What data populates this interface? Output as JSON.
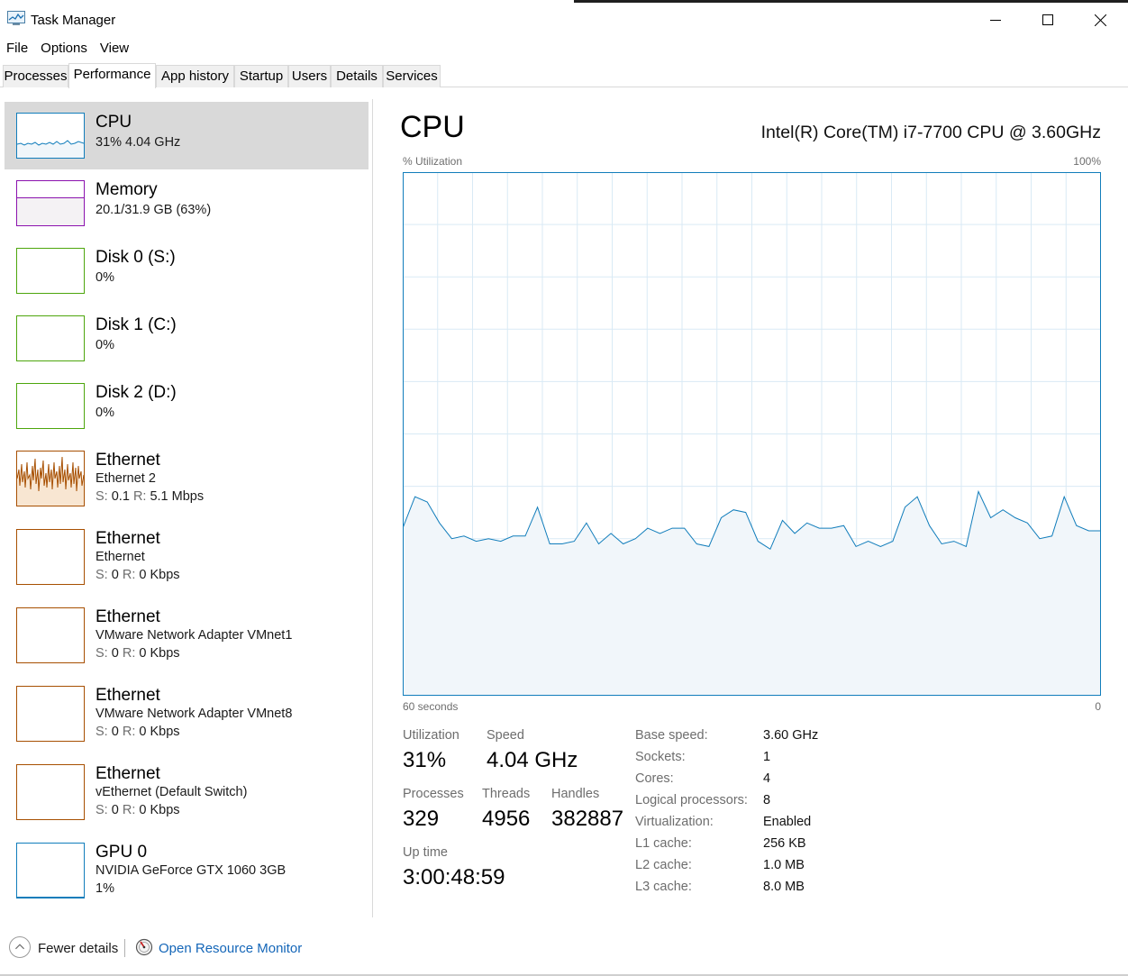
{
  "window": {
    "title": "Task Manager",
    "icon": "task-manager-icon",
    "controls": [
      "minimize-icon",
      "maximize-icon",
      "close-icon"
    ]
  },
  "menu": [
    "File",
    "Options",
    "View"
  ],
  "tabs": [
    {
      "label": "Processes",
      "active": false
    },
    {
      "label": "Performance",
      "active": true
    },
    {
      "label": "App history",
      "active": false
    },
    {
      "label": "Startup",
      "active": false
    },
    {
      "label": "Users",
      "active": false
    },
    {
      "label": "Details",
      "active": false
    },
    {
      "label": "Services",
      "active": false
    }
  ],
  "sidebar": {
    "items": [
      {
        "title": "CPU",
        "line1": "31% 4.04 GHz",
        "selected": true,
        "color": "#117dbb"
      },
      {
        "title": "Memory",
        "line1": "20.1/31.9 GB (63%)",
        "color": "#8b12ae",
        "fill": 0.63
      },
      {
        "title": "Disk 0 (S:)",
        "line1": "0%",
        "color": "#4da60c"
      },
      {
        "title": "Disk 1 (C:)",
        "line1": "0%",
        "color": "#4da60c"
      },
      {
        "title": "Disk 2 (D:)",
        "line1": "0%",
        "color": "#4da60c"
      },
      {
        "title": "Ethernet",
        "line1": "Ethernet 2",
        "send_label": "S:",
        "send": "0.1",
        "recv_label": "R:",
        "recv": "5.1 Mbps",
        "color": "#a74f01"
      },
      {
        "title": "Ethernet",
        "line1": "Ethernet",
        "send_label": "S:",
        "send": "0",
        "recv_label": "R:",
        "recv": "0 Kbps",
        "color": "#a74f01"
      },
      {
        "title": "Ethernet",
        "line1": "VMware Network Adapter VMnet1",
        "send_label": "S:",
        "send": "0",
        "recv_label": "R:",
        "recv": "0 Kbps",
        "color": "#a74f01"
      },
      {
        "title": "Ethernet",
        "line1": "VMware Network Adapter VMnet8",
        "send_label": "S:",
        "send": "0",
        "recv_label": "R:",
        "recv": "0 Kbps",
        "color": "#a74f01"
      },
      {
        "title": "Ethernet",
        "line1": "vEthernet (Default Switch)",
        "send_label": "S:",
        "send": "0",
        "recv_label": "R:",
        "recv": "0 Kbps",
        "color": "#a74f01"
      },
      {
        "title": "GPU 0",
        "line1": "NVIDIA GeForce GTX 1060 3GB",
        "line2": "1%",
        "color": "#117dbb"
      }
    ]
  },
  "detail": {
    "title": "CPU",
    "model": "Intel(R) Core(TM) i7-7700 CPU @ 3.60GHz",
    "axis_top_left": "% Utilization",
    "axis_top_right": "100%",
    "axis_bottom_left": "60 seconds",
    "axis_bottom_right": "0",
    "stats": {
      "utilization_label": "Utilization",
      "utilization": "31%",
      "speed_label": "Speed",
      "speed": "4.04 GHz",
      "processes_label": "Processes",
      "processes": "329",
      "threads_label": "Threads",
      "threads": "4956",
      "handles_label": "Handles",
      "handles": "382887",
      "uptime_label": "Up time",
      "uptime": "3:00:48:59"
    },
    "specs": [
      {
        "label": "Base speed:",
        "value": "3.60 GHz"
      },
      {
        "label": "Sockets:",
        "value": "1"
      },
      {
        "label": "Cores:",
        "value": "4"
      },
      {
        "label": "Logical processors:",
        "value": "8"
      },
      {
        "label": "Virtualization:",
        "value": "Enabled"
      },
      {
        "label": "L1 cache:",
        "value": "256 KB"
      },
      {
        "label": "L2 cache:",
        "value": "1.0 MB"
      },
      {
        "label": "L3 cache:",
        "value": "8.0 MB"
      }
    ]
  },
  "chart_data": {
    "type": "area",
    "x_range": [
      60,
      0
    ],
    "ylim": [
      0,
      100
    ],
    "grid": true,
    "color": "#117dbb",
    "values": [
      32,
      38,
      37,
      33,
      30,
      30.5,
      29.5,
      30,
      29.5,
      30.5,
      30.5,
      36,
      29,
      29,
      29.5,
      33,
      29,
      31,
      29,
      30,
      32,
      31,
      32,
      32,
      29,
      28.5,
      34,
      35.5,
      35,
      29.5,
      28,
      33.5,
      31,
      33,
      32,
      32,
      32.5,
      28.5,
      29.5,
      28.5,
      29.5,
      36,
      38,
      32.5,
      29,
      29.5,
      28.5,
      39,
      34,
      35.5,
      34,
      33,
      30,
      30.5,
      38,
      32.5,
      31.5,
      31.5
    ]
  },
  "footer": {
    "fewer_details": "Fewer details",
    "open_resource_monitor": "Open Resource Monitor"
  }
}
